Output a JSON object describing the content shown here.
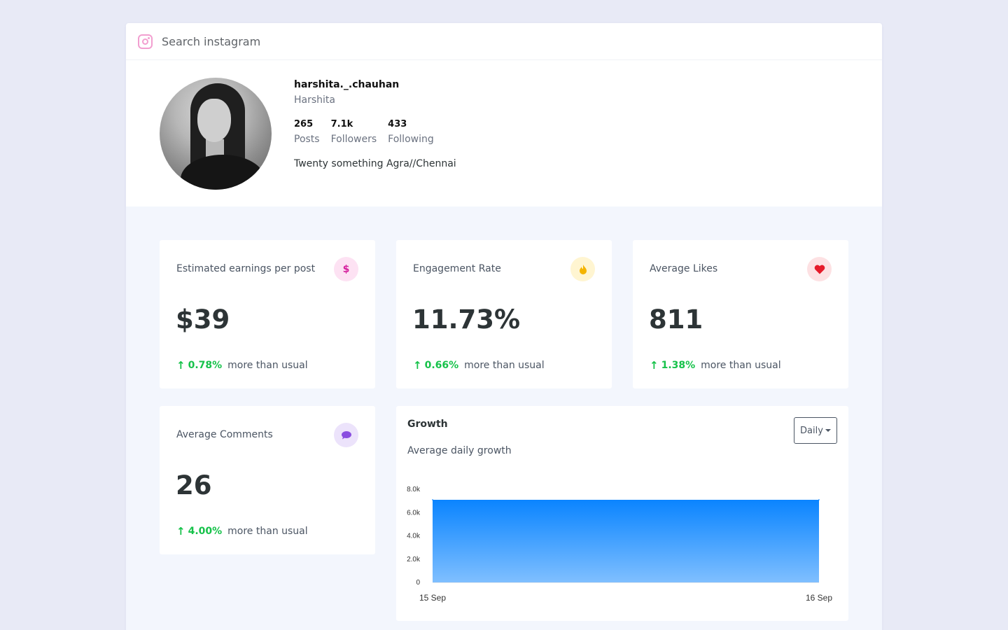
{
  "search": {
    "placeholder": "Search instagram"
  },
  "profile": {
    "username": "harshita._.chauhan",
    "full_name": "Harshita",
    "stats": [
      {
        "value": "265",
        "label": "Posts"
      },
      {
        "value": "7.1k",
        "label": "Followers"
      },
      {
        "value": "433",
        "label": "Following"
      }
    ],
    "bio": "Twenty something Agra//Chennai"
  },
  "metrics": [
    {
      "title": "Estimated earnings per post",
      "value": "$39",
      "change": "0.78%",
      "suffix": "more than usual",
      "icon": "dollar-icon",
      "badge_bg": "#fde2f3",
      "badge_color": "#d6249f"
    },
    {
      "title": "Engagement Rate",
      "value": "11.73%",
      "change": "0.66%",
      "suffix": "more than usual",
      "icon": "flame-icon",
      "badge_bg": "#fff5d1",
      "badge_color": "#f4b400"
    },
    {
      "title": "Average Likes",
      "value": "811",
      "change": "1.38%",
      "suffix": "more than usual",
      "icon": "heart-icon",
      "badge_bg": "#fde1e3",
      "badge_color": "#e61b2a"
    },
    {
      "title": "Average Comments",
      "value": "26",
      "change": "4.00%",
      "suffix": "more than usual",
      "icon": "comment-icon",
      "badge_bg": "#ece3fb",
      "badge_color": "#8a4fe0"
    }
  ],
  "growth": {
    "title": "Growth",
    "subtitle": "Average daily growth",
    "period": "Daily"
  },
  "colors": {
    "accent_green": "#16c24a",
    "chart_top": "#0a84ff",
    "chart_bottom": "#7fbfff"
  },
  "chart_data": {
    "type": "area",
    "x": [
      "15 Sep",
      "16 Sep"
    ],
    "series": [
      {
        "values": [
          7100,
          7100
        ]
      }
    ],
    "ylim": [
      0,
      8000
    ],
    "yticks": [
      0,
      2000,
      4000,
      6000,
      8000
    ],
    "ytick_labels": [
      "0",
      "2.0k",
      "4.0k",
      "6.0k",
      "8.0k"
    ],
    "grid": false,
    "legend": "none"
  }
}
